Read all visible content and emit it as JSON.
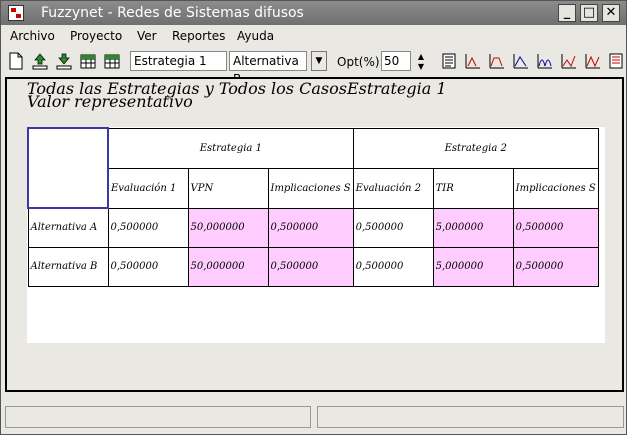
{
  "window": {
    "title": "Fuzzynet - Redes de Sistemas difusos"
  },
  "menu": [
    "Archivo",
    "Proyecto",
    "Ver",
    "Reportes",
    "Ayuda"
  ],
  "toolbar": {
    "estrategia_value": "Estrategia 1",
    "alternativa_value": "Alternativa B",
    "opt_label": "Opt(%):",
    "opt_value": "50"
  },
  "main": {
    "heading1": "Todas las Estrategias y Todos los CasosEstrategia 1",
    "heading2": "Valor representativo"
  },
  "table": {
    "groups": [
      "Estrategia 1",
      "Estrategia 2"
    ],
    "columns": [
      "Evaluación 1",
      "VPN",
      "Implicaciones S",
      "Evaluación 2",
      "TIR",
      "Implicaciones S"
    ],
    "rows": [
      {
        "label": "Alternativa A",
        "cells": [
          "0,500000",
          "50,000000",
          "0,500000",
          "0,500000",
          "5,000000",
          "0,500000"
        ]
      },
      {
        "label": "Alternativa B",
        "cells": [
          "0,500000",
          "50,000000",
          "0,500000",
          "0,500000",
          "5,000000",
          "0,500000"
        ]
      }
    ]
  },
  "icons": [
    "app-icon",
    "minimize-icon",
    "maximize-icon",
    "close-icon",
    "new-file-icon",
    "upload-icon",
    "download-icon",
    "table-icon",
    "table-edit-icon",
    "chevron-down-icon",
    "spin-up-icon",
    "spin-down-icon",
    "report-icon",
    "chart-icon"
  ],
  "colors": {
    "highlight": "#ffccff",
    "titlebar": "#7a7a7a",
    "selection_border": "#3a3aa0"
  }
}
